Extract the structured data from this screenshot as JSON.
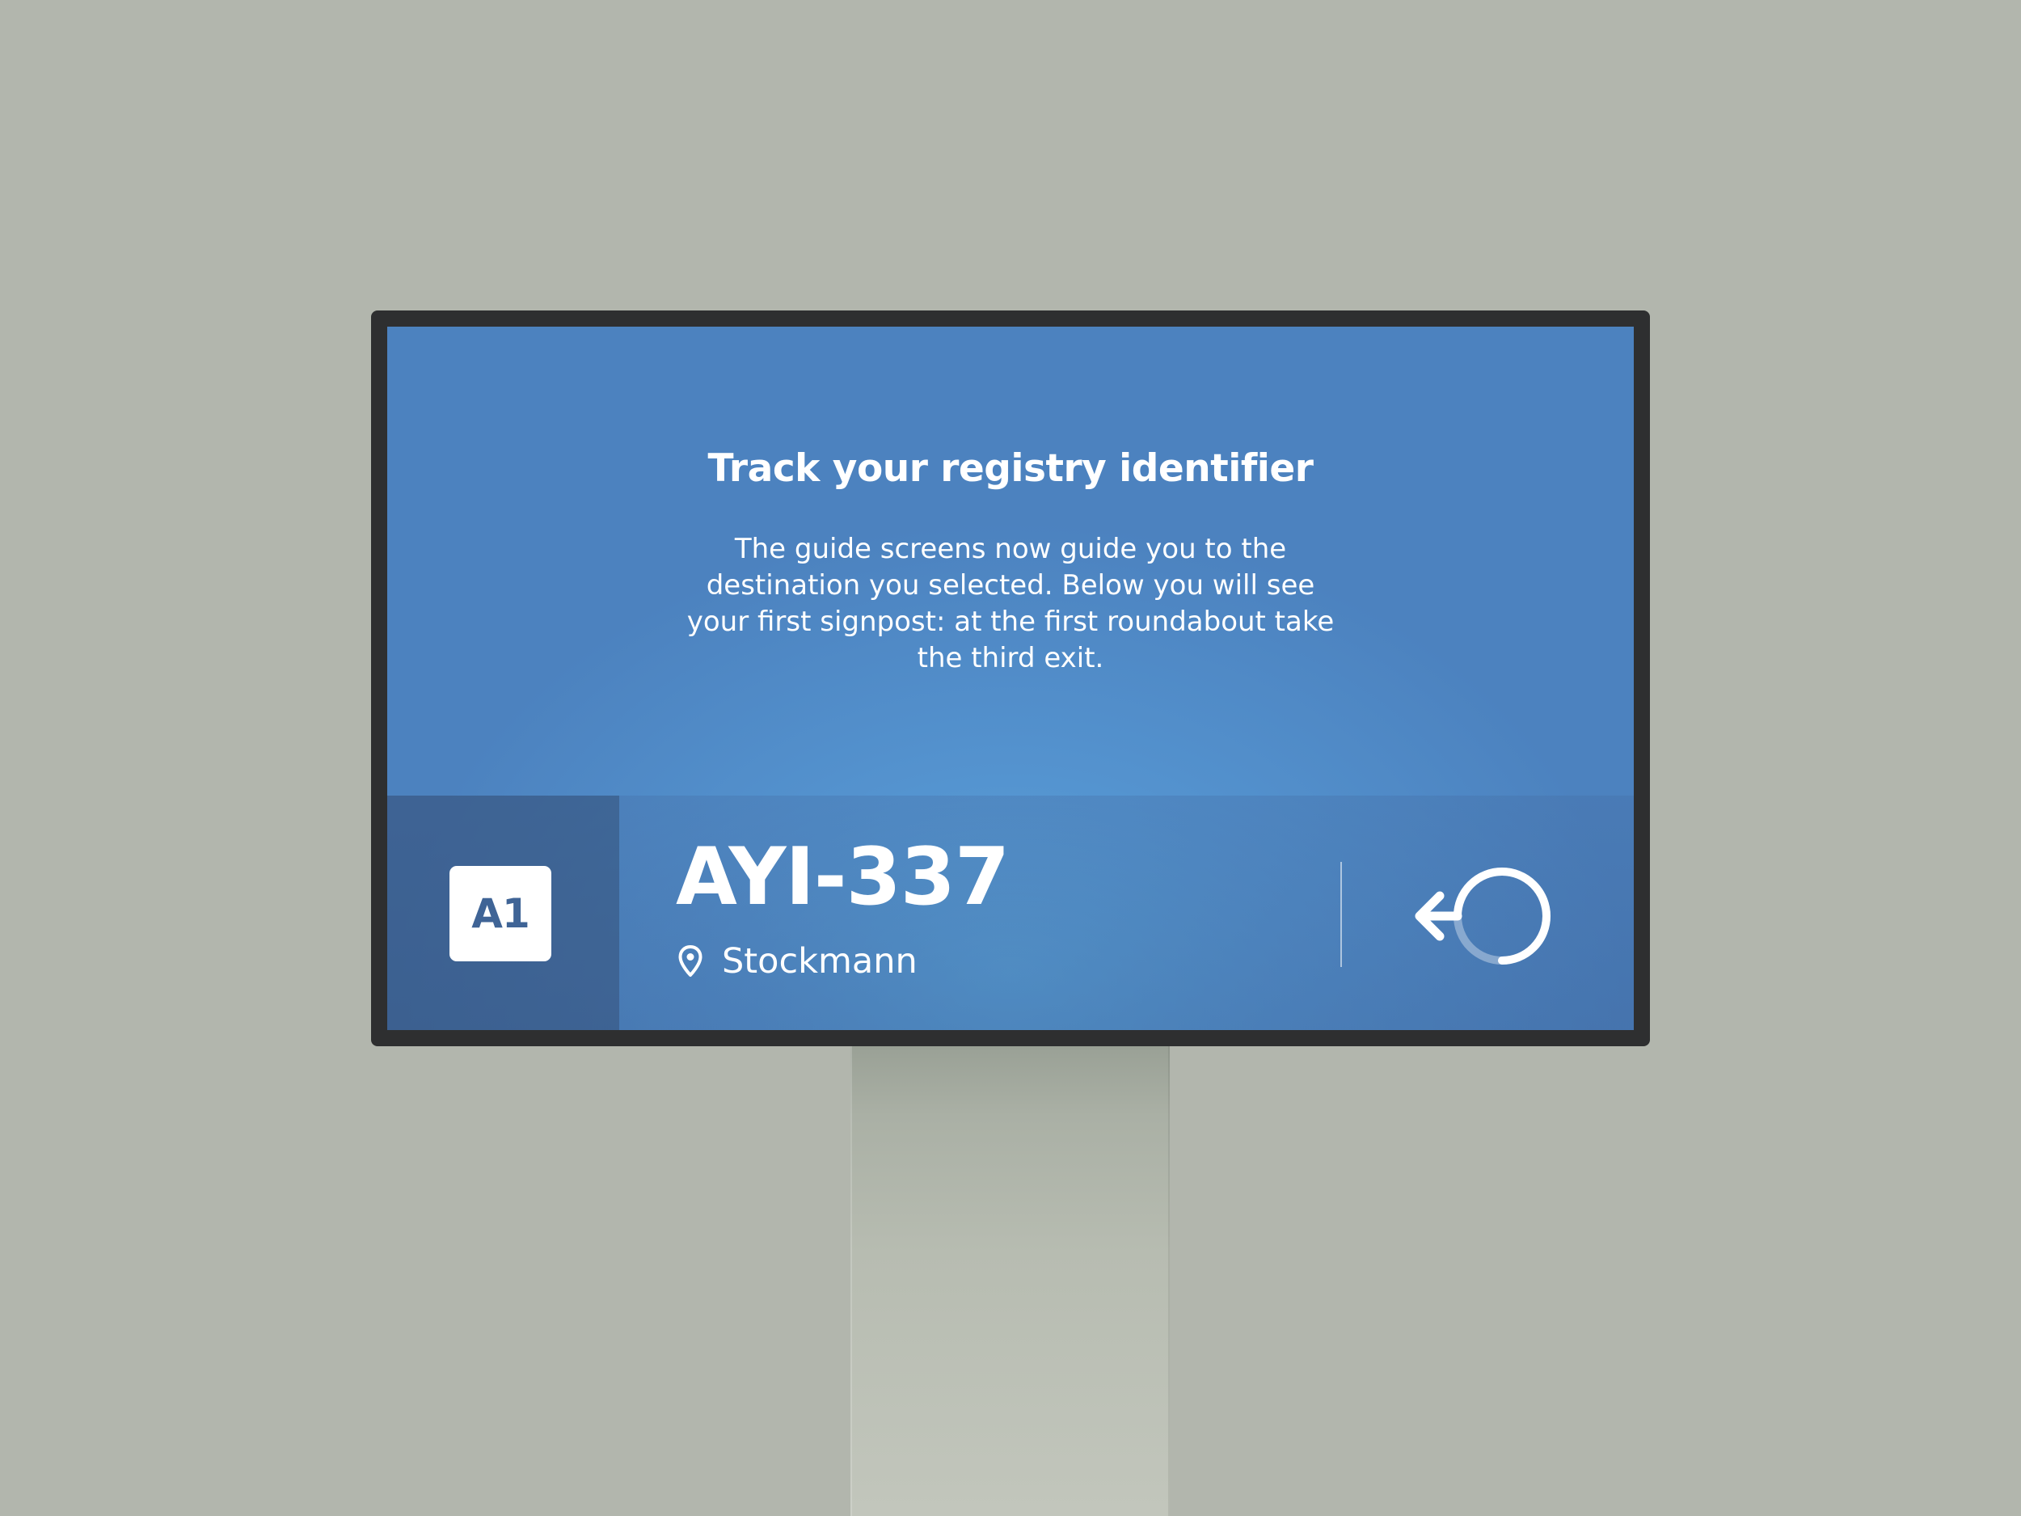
{
  "screen": {
    "heading": "Track your registry identifier",
    "instructions": "The guide screens now guide you to the destination you selected. Below you will see your first signpost: at the first roundabout take the third exit."
  },
  "signpost": {
    "road_badge": "A1",
    "plate": "AYI-337",
    "location": "Stockmann",
    "location_icon": "location-pin-icon",
    "direction_icon": "roundabout-third-exit-icon"
  },
  "colors": {
    "background": "#b2b6ad",
    "screen_blue": "#5493cf",
    "bezel": "#2e2f30",
    "badge_text": "#3f6496"
  }
}
